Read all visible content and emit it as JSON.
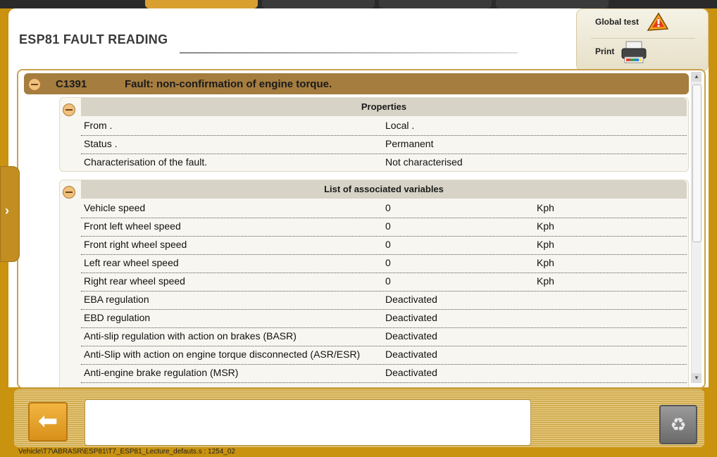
{
  "header": {
    "title": "ESP81  FAULT READING"
  },
  "actions": {
    "global_test": "Global test",
    "print": "Print"
  },
  "fault": {
    "code": "C1391",
    "description": "Fault: non-confirmation of engine torque."
  },
  "properties": {
    "title": "Properties",
    "rows": [
      {
        "label": "From .",
        "value": "Local ."
      },
      {
        "label": "Status .",
        "value": "Permanent"
      },
      {
        "label": "Characterisation of the fault.",
        "value": "Not characterised"
      }
    ]
  },
  "variables": {
    "title": "List of associated variables",
    "rows": [
      {
        "label": "Vehicle speed",
        "value": "0",
        "unit": "Kph"
      },
      {
        "label": "Front left wheel speed",
        "value": "0",
        "unit": "Kph"
      },
      {
        "label": "Front right wheel speed",
        "value": "0",
        "unit": "Kph"
      },
      {
        "label": "Left rear wheel speed",
        "value": "0",
        "unit": "Kph"
      },
      {
        "label": "Right rear wheel speed",
        "value": "0",
        "unit": "Kph"
      },
      {
        "label": "EBA regulation",
        "value": "Deactivated",
        "unit": ""
      },
      {
        "label": "EBD regulation",
        "value": "Deactivated",
        "unit": ""
      },
      {
        "label": "Anti-slip regulation with action on brakes (BASR)",
        "value": "Deactivated",
        "unit": ""
      },
      {
        "label": "Anti-Slip with action on engine torque disconnected (ASR/ESR)",
        "value": "Deactivated",
        "unit": ""
      },
      {
        "label": "Anti-engine brake regulation (MSR)",
        "value": "Deactivated",
        "unit": ""
      }
    ]
  },
  "footer": {
    "path": "Vehicle\\T7\\ABRASR\\ESP81\\T7_ESP81_Lecture_defauts.s : 1254_02"
  },
  "icons": {
    "back": "arrow-left-icon",
    "trash": "recycle-bin-icon",
    "global_test": "warning-icon",
    "print": "printer-icon",
    "side": "chevron-right-icon"
  },
  "colors": {
    "accent": "#c9920f",
    "fault_header": "#a57d3f"
  }
}
